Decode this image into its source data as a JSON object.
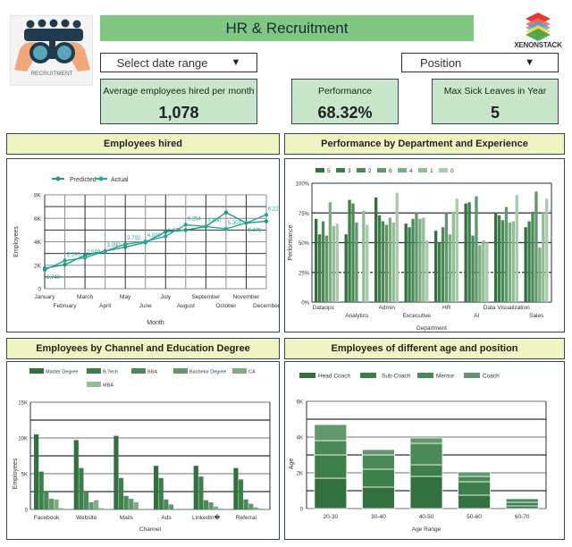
{
  "header": {
    "title": "HR & Recruitment",
    "logo_caption": "RECRUITMENT",
    "brand": "XENONSTACK",
    "date_dropdown": "Select date range",
    "position_dropdown": "Position",
    "dropdown_icon": "▼"
  },
  "kpis": [
    {
      "label": "Average employees hired per month",
      "value": "1,078"
    },
    {
      "label": "Performance",
      "value": "68.32%"
    },
    {
      "label": "Max Sick Leaves in Year",
      "value": "5"
    }
  ],
  "sections": {
    "hired": "Employees hired",
    "performance": "Performance by Department and Experience",
    "channel": "Employees by Channel and Education Degree",
    "age": "Employees of different age and  position"
  },
  "colors": {
    "title_bg": "#81c784",
    "kpi_bg": "#c8e6c9",
    "section_bg": "#f0f4c3",
    "line_predicted": "#1e9e6e",
    "line_actual": "#26a69a",
    "greens": [
      "#33703f",
      "#3d7f4a",
      "#4b8a58",
      "#62986b",
      "#7cae82",
      "#93bd96",
      "#a9cbab"
    ]
  },
  "chart_data": [
    {
      "type": "line",
      "title": "Employees hired",
      "xlabel": "Month",
      "ylabel": "Employees",
      "ylim": [
        0,
        8000
      ],
      "yticks": [
        "0",
        "2K",
        "4K",
        "6K",
        "8K"
      ],
      "categories": [
        "January",
        "February",
        "March",
        "April",
        "May",
        "June",
        "July",
        "August",
        "September",
        "October",
        "November",
        "December"
      ],
      "legend": [
        "Predicted",
        "Actual"
      ],
      "legend_position": "top-left",
      "series": [
        {
          "name": "Predicted",
          "values": [
            1740,
            2050,
            2850,
            3200,
            3550,
            3950,
            4850,
            5000,
            5300,
            6500,
            5600,
            5750
          ]
        },
        {
          "name": "Actual",
          "values": [
            1600,
            2390,
            2640,
            3200,
            3792,
            4020,
            4470,
            5454,
            5300,
            5100,
            5600,
            6300
          ]
        }
      ],
      "data_labels": [
        {
          "i": 0,
          "text": "1,740",
          "pos": "below"
        },
        {
          "i": 1,
          "text": "2,190",
          "pos": "above"
        },
        {
          "i": 2,
          "text": "2,640",
          "pos": "above"
        },
        {
          "i": 3,
          "text": "3,090",
          "pos": "above"
        },
        {
          "i": 4,
          "text": "3,792",
          "pos": "above"
        },
        {
          "i": 5,
          "text": "4,020",
          "pos": "above"
        },
        {
          "i": 6,
          "text": "4,470",
          "pos": "above"
        },
        {
          "i": 7,
          "text": "5,254",
          "pos": "above"
        },
        {
          "i": 8,
          "text": "5,400",
          "pos": "above"
        },
        {
          "i": 9,
          "text": "5,303",
          "pos": "above"
        },
        {
          "i": 10,
          "text": "5,475",
          "pos": "below"
        },
        {
          "i": 11,
          "text": "6,223",
          "pos": "above"
        }
      ]
    },
    {
      "type": "bar",
      "title": "Performance by Department and Experience",
      "xlabel": "Department",
      "ylabel": "Performance",
      "ylim": [
        0,
        100
      ],
      "yticks": [
        "0%",
        "25%",
        "50%",
        "75%",
        "100%"
      ],
      "categories": [
        "Dataops",
        "Analytics",
        "Admin",
        "Excecutive",
        "HR",
        "AI",
        "Data Visualization",
        "Sales"
      ],
      "legend_position": "top-left",
      "series": [
        {
          "name": "5",
          "values": [
            70,
            57,
            88,
            66,
            60,
            83,
            75,
            63
          ]
        },
        {
          "name": "3",
          "values": [
            57,
            86,
            73,
            63,
            50,
            84,
            73,
            68
          ]
        },
        {
          "name": "2",
          "values": [
            68,
            83,
            68,
            70,
            63,
            56,
            69,
            76
          ]
        },
        {
          "name": "6",
          "values": [
            56,
            67,
            65,
            75,
            75,
            89,
            80,
            93
          ]
        },
        {
          "name": "4",
          "values": [
            84,
            0,
            71,
            70,
            57,
            48,
            67,
            46
          ]
        },
        {
          "name": "1",
          "values": [
            64,
            77,
            67,
            71,
            76,
            52,
            68,
            75
          ]
        },
        {
          "name": "0",
          "values": [
            66,
            65,
            92,
            52,
            87,
            50,
            90,
            87
          ]
        }
      ]
    },
    {
      "type": "bar",
      "title": "Employees by Channel and Education Degree",
      "xlabel": "Channel",
      "ylabel": "Employees",
      "ylim": [
        0,
        15000
      ],
      "yticks": [
        "0",
        "5K",
        "10K",
        "15K"
      ],
      "categories": [
        "Facebook",
        "Website",
        "Mails",
        "Ads",
        "LinkedIn�",
        "Referral"
      ],
      "legend_position": "top",
      "series": [
        {
          "name": "Master Degree",
          "values": [
            10500,
            9700,
            10300,
            6100,
            6100,
            5800
          ]
        },
        {
          "name": "B.Tech",
          "values": [
            5300,
            5800,
            4400,
            4400,
            4600,
            4200
          ]
        },
        {
          "name": "BBA",
          "values": [
            2600,
            2400,
            1900,
            1400,
            1300,
            1400
          ]
        },
        {
          "name": "Bachelor Degree",
          "values": [
            1500,
            1000,
            1500,
            700,
            1000,
            800
          ]
        },
        {
          "name": "CA",
          "values": [
            1400,
            1300,
            1000,
            0,
            400,
            300
          ]
        },
        {
          "name": "MBA",
          "values": [
            200,
            200,
            0,
            0,
            150,
            150
          ]
        }
      ]
    },
    {
      "type": "bar",
      "stacked": true,
      "title": "Employees of different age and  position",
      "xlabel": "Age Range",
      "ylabel": "Age",
      "ylim": [
        0,
        6000
      ],
      "yticks": [
        "0",
        "2K",
        "4K",
        "6K"
      ],
      "categories": [
        "20-30",
        "30-40",
        "40-50",
        "50-60",
        "60-70"
      ],
      "legend_position": "top",
      "series": [
        {
          "name": "Head Coach",
          "values": [
            1700,
            1200,
            1800,
            750,
            150
          ]
        },
        {
          "name": "Sub-Coach",
          "values": [
            1300,
            1000,
            650,
            750,
            200
          ]
        },
        {
          "name": "Mentor",
          "values": [
            800,
            800,
            1200,
            300,
            200
          ]
        },
        {
          "name": "Coach",
          "values": [
            900,
            300,
            300,
            250,
            0
          ]
        }
      ]
    }
  ]
}
